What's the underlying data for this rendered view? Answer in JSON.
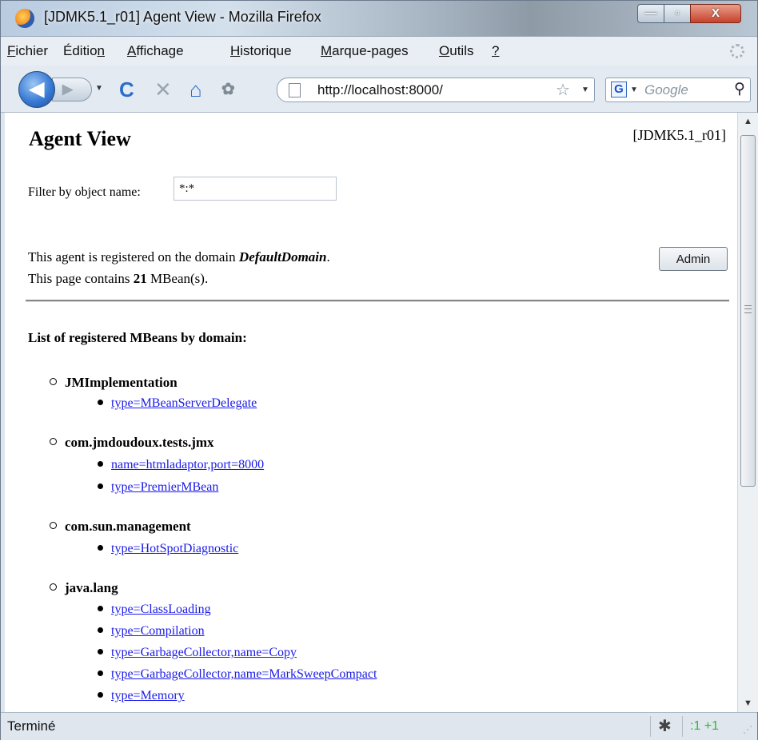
{
  "window": {
    "title": "[JDMK5.1_r01] Agent View - Mozilla Firefox",
    "min_glyph": "—",
    "max_glyph": "▫",
    "close_glyph": "X"
  },
  "menu": {
    "items": [
      {
        "pre": "",
        "u": "F",
        "post": "ichier"
      },
      {
        "pre": "Éditio",
        "u": "n",
        "post": ""
      },
      {
        "pre": "",
        "u": "A",
        "post": "ffichage"
      },
      {
        "pre": "",
        "u": "H",
        "post": "istorique"
      },
      {
        "pre": "",
        "u": "M",
        "post": "arque-pages"
      },
      {
        "pre": "",
        "u": "O",
        "post": "utils"
      },
      {
        "pre": "",
        "u": "?",
        "post": ""
      }
    ]
  },
  "nav": {
    "back_glyph": "◀",
    "forward_glyph": "▶",
    "dropdown_glyph": "▼",
    "reload_glyph": "C",
    "stop_glyph": "✕",
    "home_glyph": "⌂",
    "plugin_glyph": "✿",
    "url": "http://localhost:8000/",
    "bookmark_glyph": "☆",
    "search_engine_letter": "G",
    "search_placeholder": "Google",
    "search_glyph": "⚲"
  },
  "page": {
    "title": "Agent View",
    "version": "[JDMK5.1_r01]",
    "filter_label": "Filter by object name:",
    "filter_value": "*:*",
    "info_domain_prefix": "This agent is registered on the domain ",
    "info_domain": "DefaultDomain",
    "info_domain_suffix": ".",
    "info_count_prefix": "This page contains ",
    "info_count": "21",
    "info_count_suffix": " MBean(s).",
    "admin_label": "Admin",
    "list_heading": "List of registered MBeans by domain:"
  },
  "domains": [
    {
      "name": "JMImplementation",
      "mbeans": [
        "type=MBeanServerDelegate"
      ]
    },
    {
      "name": "com.jmdoudoux.tests.jmx",
      "mbeans": [
        "name=htmladaptor,port=8000",
        "type=PremierMBean"
      ]
    },
    {
      "name": "com.sun.management",
      "mbeans": [
        "type=HotSpotDiagnostic"
      ]
    },
    {
      "name": "java.lang",
      "mbeans": [
        "type=ClassLoading",
        "type=Compilation",
        "type=GarbageCollector,name=Copy",
        "type=GarbageCollector,name=MarkSweepCompact",
        "type=Memory"
      ]
    }
  ],
  "scrollbar": {
    "up_glyph": "▲",
    "down_glyph": "▼"
  },
  "status": {
    "text": "Terminé",
    "bug_glyph": "✱",
    "counter": ":1 +1",
    "grip_glyph": "⋰"
  },
  "colors": {
    "link": "#1a1ae8",
    "counter": "#2bbb2b"
  }
}
